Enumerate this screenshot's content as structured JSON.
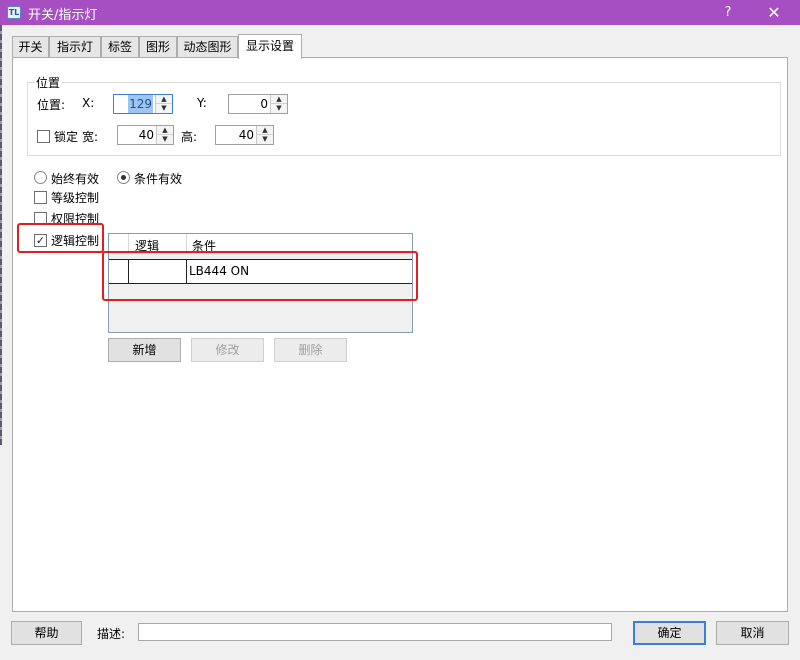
{
  "window": {
    "title": "开关/指示灯",
    "icon_text": "TL",
    "help_glyph": "?",
    "close_glyph": "✕"
  },
  "tabs": [
    {
      "label": "开关",
      "active": false
    },
    {
      "label": "指示灯",
      "active": false
    },
    {
      "label": "标签",
      "active": false
    },
    {
      "label": "图形",
      "active": false
    },
    {
      "label": "动态图形",
      "active": false
    },
    {
      "label": "显示设置",
      "active": true
    }
  ],
  "position": {
    "group_title": "位置",
    "row_label": "位置:",
    "x_label": "X:",
    "x_value": "129",
    "y_label": "Y:",
    "y_value": "0",
    "lock_label": "锁定",
    "lock_checked": false,
    "width_label": "宽:",
    "width_value": "40",
    "height_label": "高:",
    "height_value": "40"
  },
  "validity": {
    "always_label": "始终有效",
    "always_selected": false,
    "conditional_label": "条件有效",
    "conditional_selected": true
  },
  "controls": {
    "level_label": "等级控制",
    "level_checked": false,
    "permission_label": "权限控制",
    "permission_checked": false,
    "logic_label": "逻辑控制",
    "logic_checked": true
  },
  "logic_table": {
    "columns": [
      "逻辑",
      "条件"
    ],
    "rows": [
      {
        "logic": "",
        "condition": "LB444 ON"
      }
    ]
  },
  "table_buttons": {
    "add": "新增",
    "modify": "修改",
    "delete": "删除"
  },
  "footer": {
    "help": "帮助",
    "desc_label": "描述:",
    "desc_value": "",
    "ok": "确定",
    "cancel": "取消"
  },
  "icons": {
    "spin_up": "▲",
    "spin_down": "▼",
    "check_mark": "✓"
  },
  "colors": {
    "titlebar": "#a64fc2",
    "highlight_box": "#e02020",
    "focus": "#3c7fd6"
  }
}
